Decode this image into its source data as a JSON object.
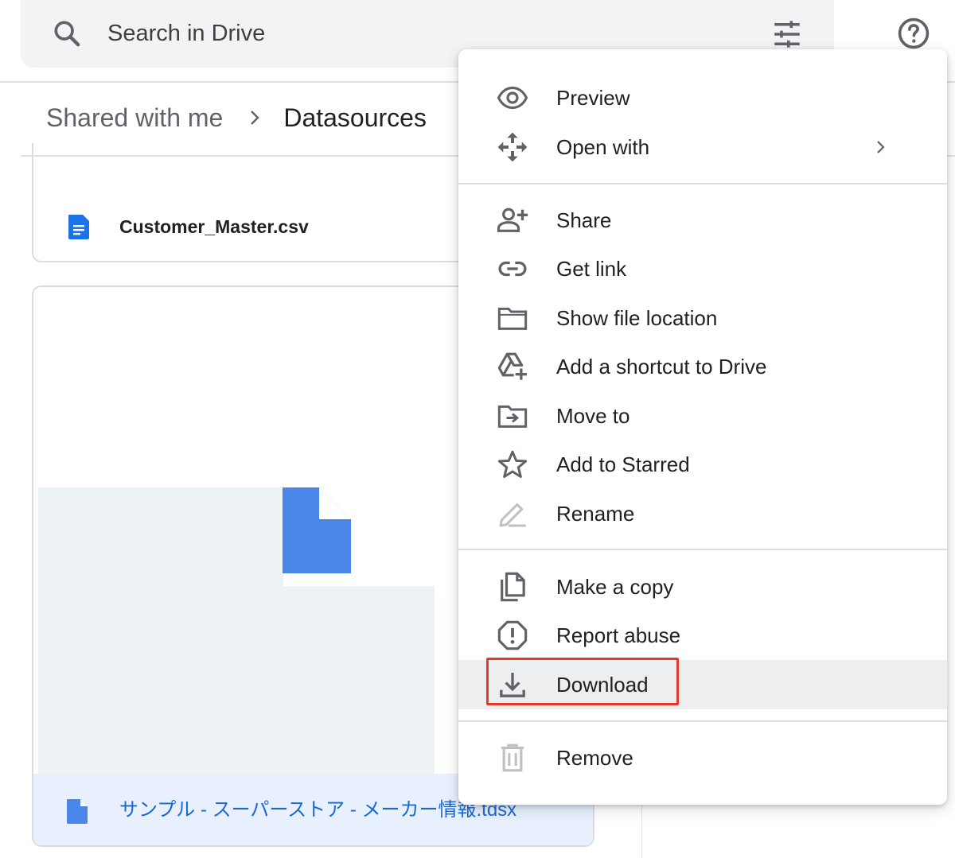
{
  "search": {
    "placeholder": "Search in Drive",
    "icons": [
      "search-icon",
      "tune-icon",
      "help-icon"
    ]
  },
  "breadcrumb": {
    "items": [
      "Shared with me",
      "Datasources"
    ]
  },
  "files": [
    {
      "name": "Customer_Master.csv",
      "icon": "doc-icon"
    },
    {
      "name": "サンプル - スーパーストア - メーカー情報.tdsx",
      "icon": "doc-icon"
    }
  ],
  "context_menu": {
    "items": [
      {
        "label": "Preview",
        "icon": "eye-icon"
      },
      {
        "label": "Open with",
        "icon": "move-icon",
        "submenu": true
      },
      {
        "label": "Share",
        "icon": "person-add-icon"
      },
      {
        "label": "Get link",
        "icon": "link-icon"
      },
      {
        "label": "Show file location",
        "icon": "folder-icon"
      },
      {
        "label": "Add a shortcut to Drive",
        "icon": "drive-shortcut-icon"
      },
      {
        "label": "Move to",
        "icon": "move-to-folder-icon"
      },
      {
        "label": "Add to Starred",
        "icon": "star-icon"
      },
      {
        "label": "Rename",
        "icon": "pencil-icon",
        "disabled": true
      },
      {
        "label": "Make a copy",
        "icon": "copy-icon"
      },
      {
        "label": "Report abuse",
        "icon": "report-icon"
      },
      {
        "label": "Download",
        "icon": "download-icon",
        "highlighted": true
      },
      {
        "label": "Remove",
        "icon": "trash-icon",
        "disabled": true
      }
    ]
  },
  "colors": {
    "accent": "#1a73e8",
    "highlight_box": "#e53a2a",
    "file_icon": "#4285f4"
  }
}
